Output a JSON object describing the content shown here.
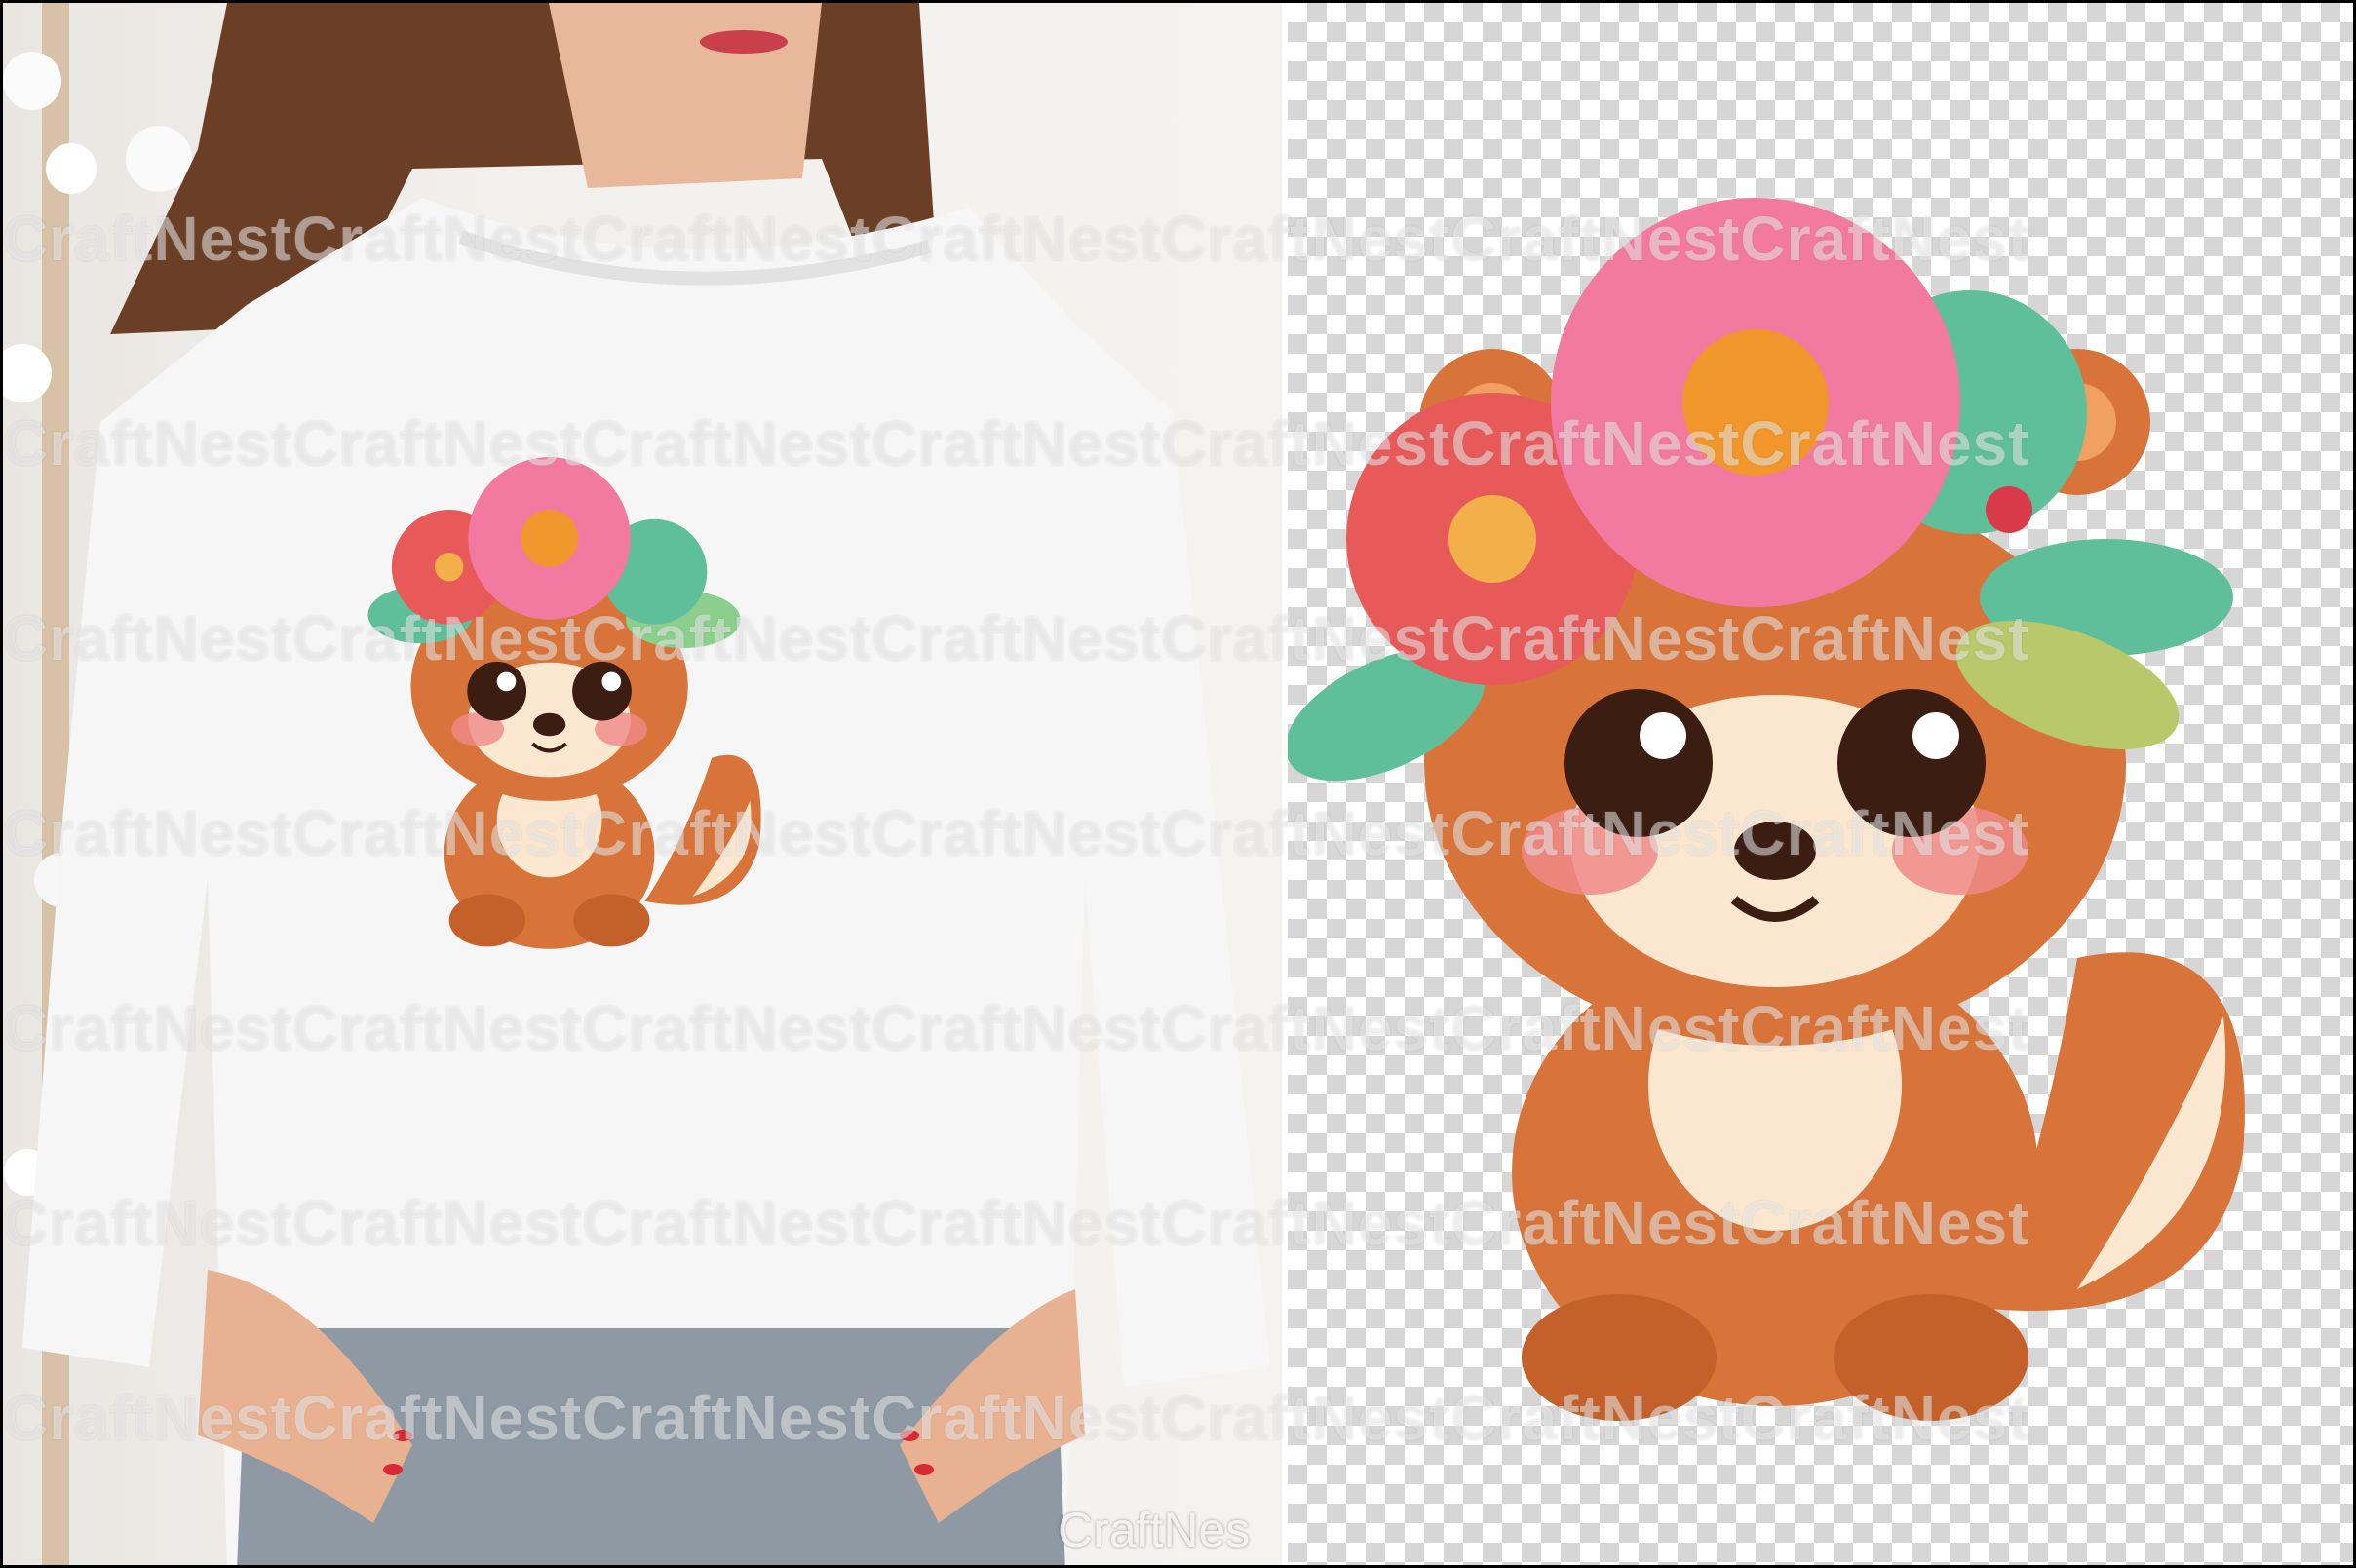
{
  "watermark": {
    "text": "CraftNestCraftNestCraftNestCraftNestCraftNestCraftNestCraftNest",
    "corner_text": "CraftNes"
  },
  "colors": {
    "fur": "#d8743a",
    "fur_dark": "#b85a26",
    "cream": "#fbe7cf",
    "petal_pink": "#f27aa0",
    "petal_red": "#e85a5a",
    "leaf_green": "#5fbf9a",
    "flower_center": "#f0962a"
  }
}
